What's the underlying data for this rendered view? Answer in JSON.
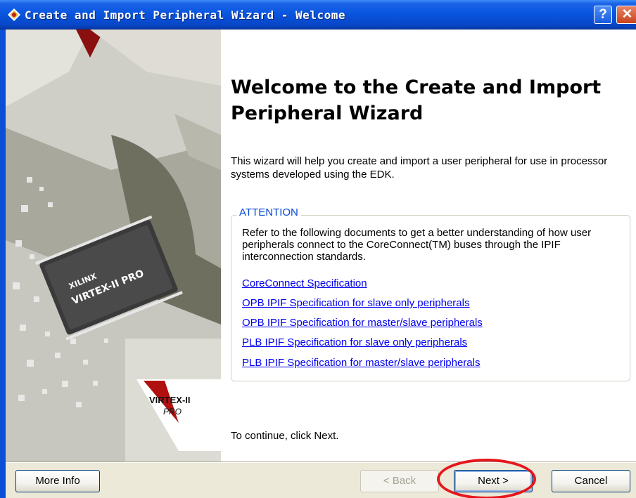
{
  "window": {
    "title": "Create and Import Peripheral Wizard - Welcome",
    "help_label": "?",
    "close_label": "✕"
  },
  "banner": {
    "chip_brand": "XILINX",
    "chip_name": "VIRTEX-II PRO",
    "logo_text": "VIRTEX-II",
    "logo_sub": "PRO"
  },
  "main": {
    "heading": "Welcome to the Create and Import Peripheral Wizard",
    "intro": "This wizard will help you create and import a user peripheral for use in processor systems developed using the EDK.",
    "attention": {
      "legend": "ATTENTION",
      "description": "Refer to the following documents to get a better understanding of how user peripherals connect to the CoreConnect(TM) buses through the IPIF interconnection standards.",
      "links": [
        "CoreConnect Specification",
        "OPB IPIF Specification for slave only peripherals",
        "OPB IPIF Specification for master/slave peripherals",
        "PLB IPIF Specification for slave only peripherals",
        "PLB IPIF Specification for master/slave peripherals"
      ]
    },
    "continue_text": "To continue, click Next."
  },
  "buttons": {
    "more_info": "More Info",
    "back": "< Back",
    "next": "Next >",
    "cancel": "Cancel"
  },
  "colors": {
    "titlebar": "#0a56e0",
    "link": "#0000ee",
    "legend": "#0046d5",
    "highlight": "#e5171c"
  }
}
